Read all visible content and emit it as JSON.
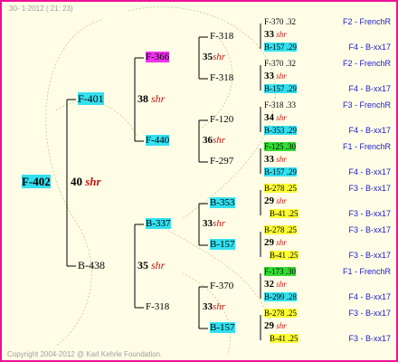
{
  "header": "30-  1-2012 ( 21: 23)",
  "copyright": "Copyright 2004-2012 @ Karl Kehrle Foundation.",
  "g1": {
    "name": "F-402",
    "ia": "40",
    "shr": "shr"
  },
  "g2": [
    {
      "name": "F-401",
      "ia": "38",
      "shr": "shr"
    },
    {
      "name": "B-438",
      "ia": "35",
      "shr": "shr"
    }
  ],
  "g3": [
    {
      "name": "F-366",
      "ia": "35",
      "shr": "shr"
    },
    {
      "name": "F-440",
      "ia": "36",
      "shr": "shr"
    },
    {
      "name": "B-337",
      "ia": "33",
      "shr": "shr"
    },
    {
      "name": "F-318",
      "ia": "33",
      "shr": "shr"
    }
  ],
  "g4": [
    {
      "name": "F-318"
    },
    {
      "name": "F-318"
    },
    {
      "name": "F-120"
    },
    {
      "name": "F-297"
    },
    {
      "name": "B-353"
    },
    {
      "name": "B-157"
    },
    {
      "name": "F-370"
    },
    {
      "name": "B-157"
    }
  ],
  "g5": [
    {
      "name": "F-370 .32",
      "ia": "33",
      "shr": "shr",
      "mother": "B-157 .29",
      "note_top": "F2 - FrenchR",
      "note_bot": "F4 - B-xx17"
    },
    {
      "name": "F-370 .32",
      "ia": "33",
      "shr": "shr",
      "mother": "B-157 .29",
      "note_top": "F2 - FrenchR",
      "note_bot": "F4 - B-xx17"
    },
    {
      "name": "F-318 .33",
      "ia": "34",
      "shr": "shr",
      "mother": "B-353 .29",
      "note_top": "F3 - FrenchR",
      "note_bot": "F4 - B-xx17"
    },
    {
      "name": "F-125 .30",
      "ia": "33",
      "shr": "shr",
      "mother": "B-157 .29",
      "note_top": "F1 - FrenchR",
      "note_bot": "F4 - B-xx17"
    },
    {
      "name": "B-278 .25",
      "ia": "29",
      "shr": "shr",
      "mother": "B-41 .25",
      "note_top": "F3 - B-xx17",
      "note_bot": "F3 - B-xx17"
    },
    {
      "name": "B-278 .25",
      "ia": "29",
      "shr": "shr",
      "mother": "B-41 .25",
      "note_top": "F3 - B-xx17",
      "note_bot": "F3 - B-xx17"
    },
    {
      "name": "F-173 .30",
      "ia": "32",
      "shr": "shr",
      "mother": "B-299 .28",
      "note_top": "F1 - FrenchR",
      "note_bot": "F4 - B-xx17"
    },
    {
      "name": "B-278 .25",
      "ia": "29",
      "shr": "shr",
      "mother": "B-41 .25",
      "note_top": "F3 - B-xx17",
      "note_bot": "F3 - B-xx17"
    }
  ]
}
